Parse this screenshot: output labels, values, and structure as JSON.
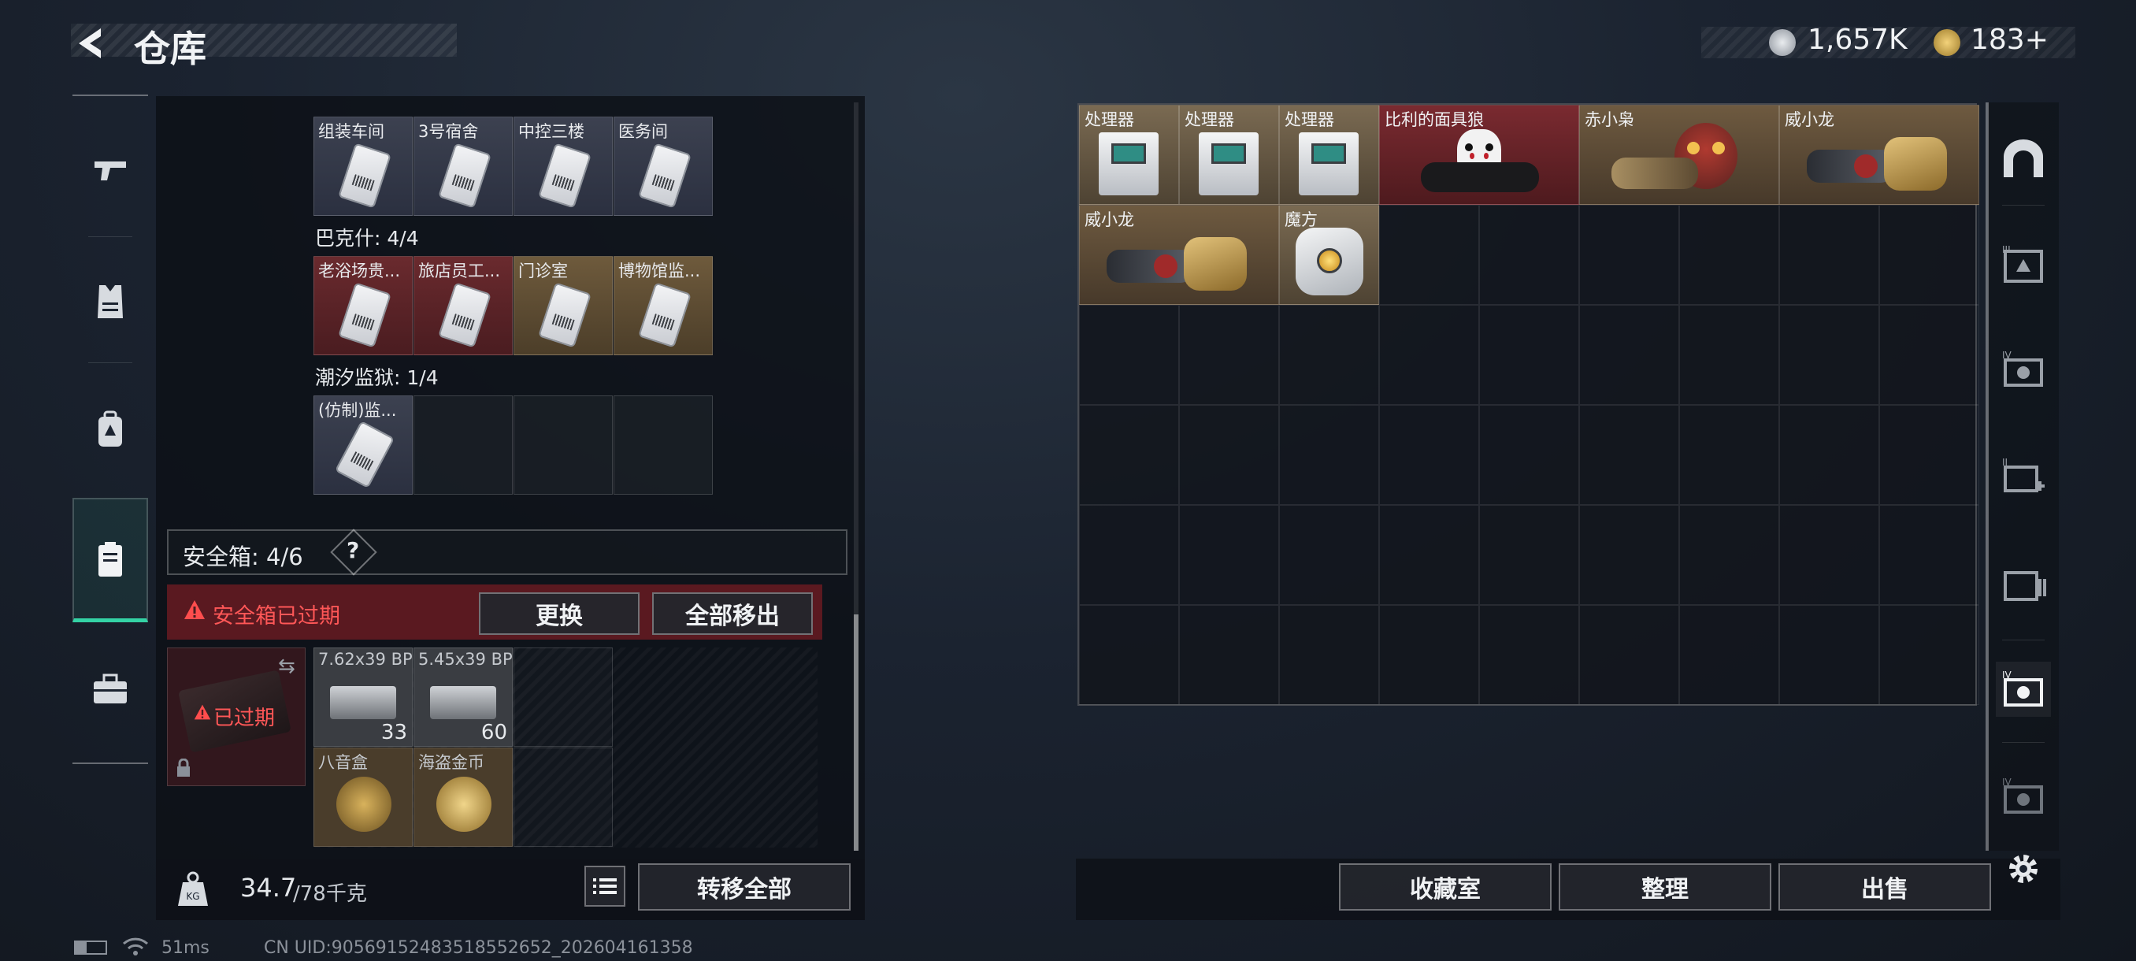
{
  "header": {
    "title": "仓库",
    "currency1": "1,657K",
    "currency2": "183+"
  },
  "nav": [
    "weapons",
    "armor",
    "backpack",
    "containers",
    "toolbox"
  ],
  "left": {
    "group1_cards": [
      "组装车间",
      "3号宿舍",
      "中控三楼",
      "医务间"
    ],
    "group2_label": "巴克什: 4/4",
    "group2_cards": [
      "老浴场贵...",
      "旅店员工...",
      "门诊室",
      "博物馆监..."
    ],
    "group3_label": "潮汐监狱: 1/4",
    "group3_cards": [
      "(仿制)监..."
    ],
    "safe_box_label": "安全箱: 4/6",
    "safe_help": "?",
    "expired_notice": "安全箱已过期",
    "replace_btn": "更换",
    "move_all_btn": "全部移出",
    "safe_expired_badge": "已过期",
    "safe_items": [
      {
        "name": "7.62x39 BP",
        "qty": "33"
      },
      {
        "name": "5.45x39 BP",
        "qty": "60"
      },
      {
        "name": "八音盒",
        "qty": ""
      },
      {
        "name": "海盗金币",
        "qty": ""
      }
    ],
    "weight_value": "34.7",
    "weight_total": "/78千克",
    "transfer_all_btn": "转移全部"
  },
  "right": {
    "items": [
      {
        "name": "处理器"
      },
      {
        "name": "处理器"
      },
      {
        "name": "处理器"
      },
      {
        "name": "比利的面具狼"
      },
      {
        "name": "赤小枭"
      },
      {
        "name": "威小龙"
      },
      {
        "name": "威小龙"
      },
      {
        "name": "魔方"
      }
    ],
    "collection_btn": "收藏室",
    "sort_btn": "整理",
    "sell_btn": "出售"
  },
  "status": {
    "ping": "51ms",
    "uid": "CN UID:9056915248351855265​2_202604161358"
  },
  "colors": {
    "accent": "#34d3a5",
    "alert": "#ff4d4d",
    "rarity_red": "#6a2a2e",
    "rarity_gold": "#6e5a3c"
  }
}
